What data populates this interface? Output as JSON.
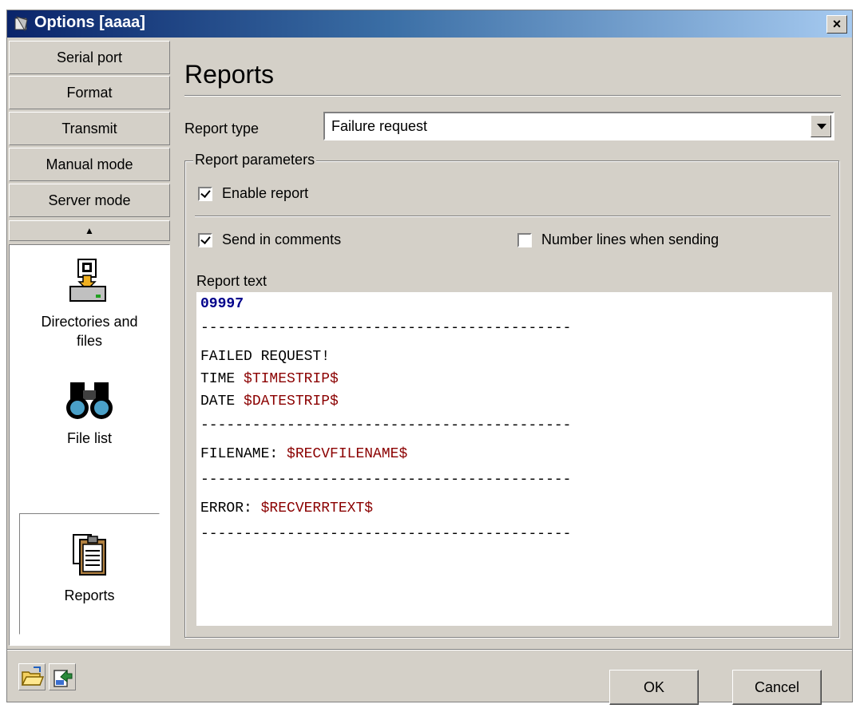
{
  "window": {
    "title": "Options [aaaa]",
    "close_label": "×"
  },
  "nav": {
    "buttons": [
      "Serial port",
      "Format",
      "Transmit",
      "Manual mode",
      "Server mode"
    ],
    "scroll_up": "▲",
    "items": [
      {
        "label_line1": "Directories and",
        "label_line2": "files",
        "icon": "directory-install-icon"
      },
      {
        "label": "File list",
        "icon": "binoculars-icon"
      },
      {
        "label": "Reports",
        "icon": "clipboard-report-icon",
        "selected": true
      }
    ]
  },
  "main": {
    "heading": "Reports",
    "report_type_label": "Report type",
    "report_type_value": "Failure request",
    "group_label": "Report parameters",
    "enable_report": {
      "label": "Enable report",
      "checked": true
    },
    "send_in_comments": {
      "label": "Send in comments",
      "checked": true
    },
    "number_lines": {
      "label": "Number lines when sending",
      "checked": false
    },
    "report_text_label": "Report text",
    "report_text": {
      "l1": "09997",
      "l2": "-------------------------------------------",
      "l3": "FAILED REQUEST!",
      "l4_static": "TIME ",
      "l4_var": "$TIMESTRIP$",
      "l5_static": "DATE ",
      "l5_var": "$DATESTRIP$",
      "l6": "-------------------------------------------",
      "l7_static": "FILENAME: ",
      "l7_var": "$RECVFILENAME$",
      "l8": "-------------------------------------------",
      "l9_static": "ERROR: ",
      "l9_var": "$RECVERRTEXT$",
      "l10": "-------------------------------------------"
    }
  },
  "footer": {
    "ok_label": "OK",
    "cancel_label": "Cancel"
  },
  "colors": {
    "title_bar": "#0a246a",
    "variable": "#8b0000",
    "number": "#00008b",
    "face": "#d4d0c8"
  }
}
